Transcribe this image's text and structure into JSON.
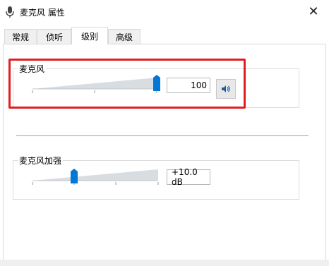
{
  "window": {
    "title": "麦克风 属性",
    "close_glyph": "✕"
  },
  "tabs": [
    {
      "label": "常规"
    },
    {
      "label": "侦听"
    },
    {
      "label": "级别"
    },
    {
      "label": "高级"
    }
  ],
  "active_tab": "级别",
  "microphone": {
    "label": "麦克风",
    "value": "100",
    "level": 1.0,
    "muted": false
  },
  "boost": {
    "label": "麦克风加强",
    "value": "+10.0 dB",
    "level": 0.333
  },
  "colors": {
    "highlight": "#e02020",
    "thumb": "#0078d7",
    "track": "#d8dde2"
  }
}
